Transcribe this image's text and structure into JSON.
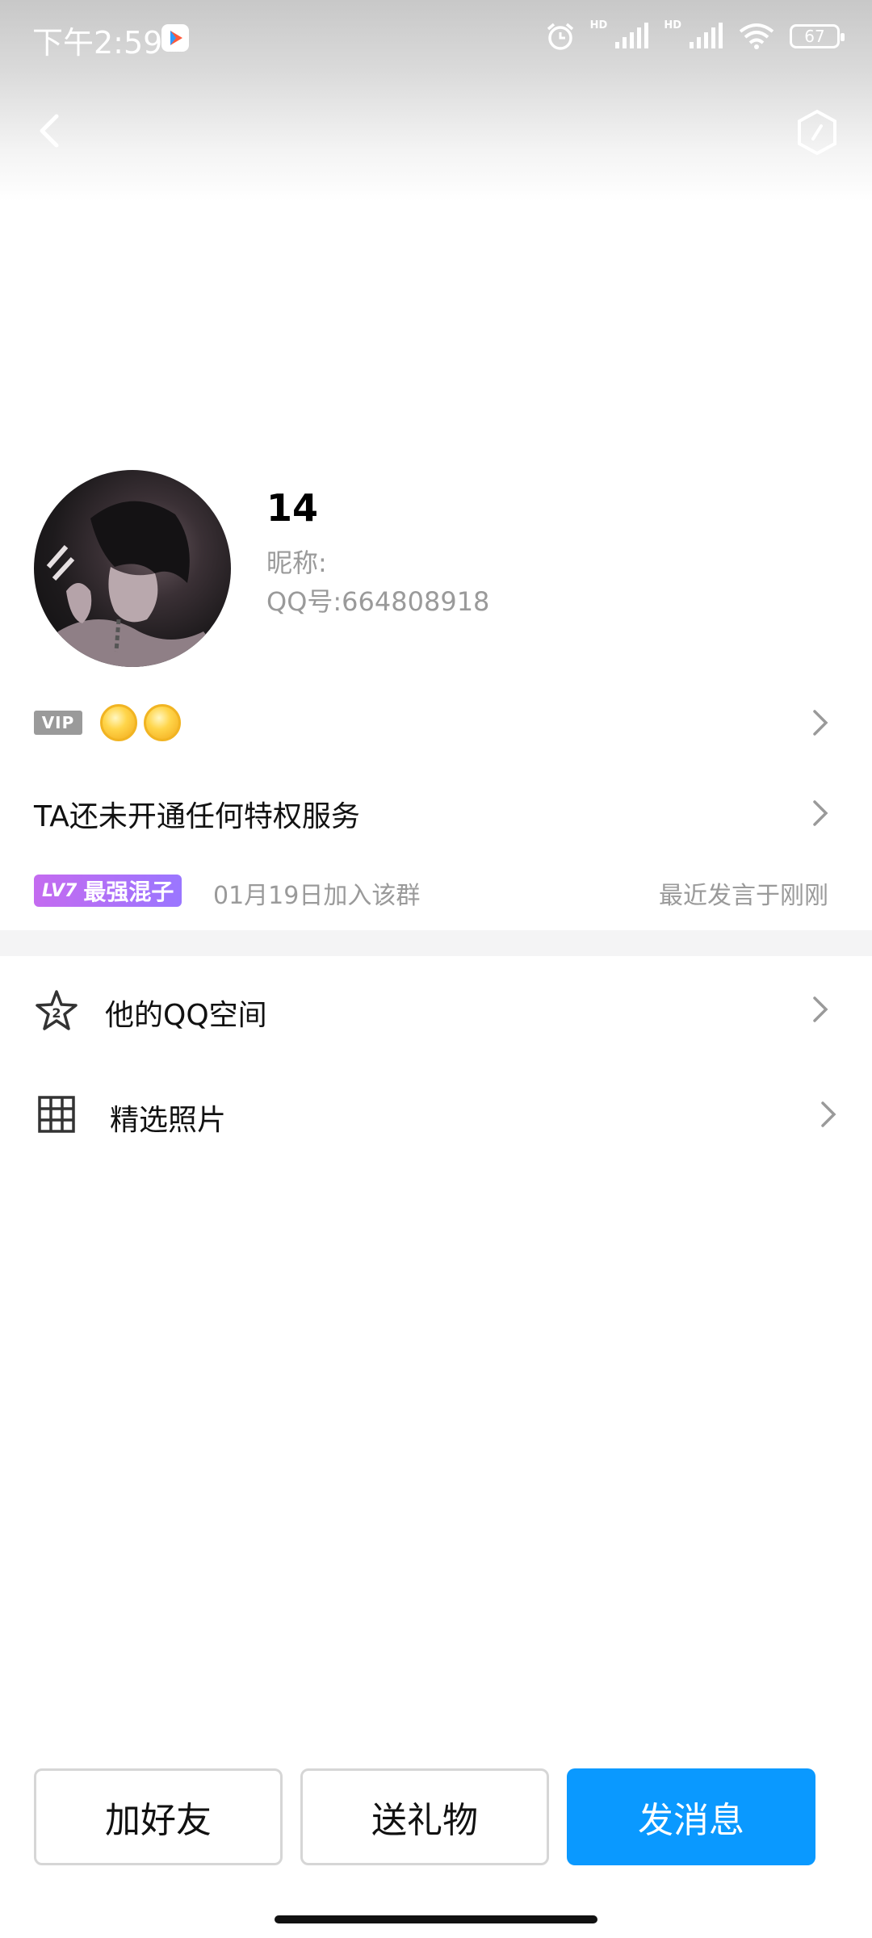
{
  "status_bar": {
    "time": "下午2:59",
    "battery": "67",
    "hd1": "HD",
    "hd2": "HD",
    "icons": [
      "alarm-icon",
      "signal-icon",
      "signal-icon",
      "wifi-icon",
      "battery-icon"
    ]
  },
  "nav": {
    "back_icon": "chevron-left-icon",
    "menu_icon": "hexagon-icon"
  },
  "profile": {
    "name": "14",
    "nickname_label": "昵称:",
    "qq_label": "QQ号:",
    "qq_number": "664808918"
  },
  "vip": {
    "badge": "VIP",
    "icons": [
      "sun-icon",
      "sun-icon"
    ]
  },
  "privilege": {
    "text": "TA还未开通任何特权服务"
  },
  "group": {
    "level": "LV7",
    "title": "最强混子",
    "joined": "01月19日加入该群",
    "last_spoke": "最近发言于刚刚"
  },
  "menu": [
    {
      "label": "他的QQ空间",
      "icon": "star-icon"
    },
    {
      "label": "精选照片",
      "icon": "grid-icon"
    }
  ],
  "actions": {
    "add_friend": "加好友",
    "send_gift": "送礼物",
    "send_message": "发消息"
  },
  "colors": {
    "primary": "#0a99ff",
    "lv_badge": "#b86ff5",
    "muted_text": "#9a9a9a"
  }
}
